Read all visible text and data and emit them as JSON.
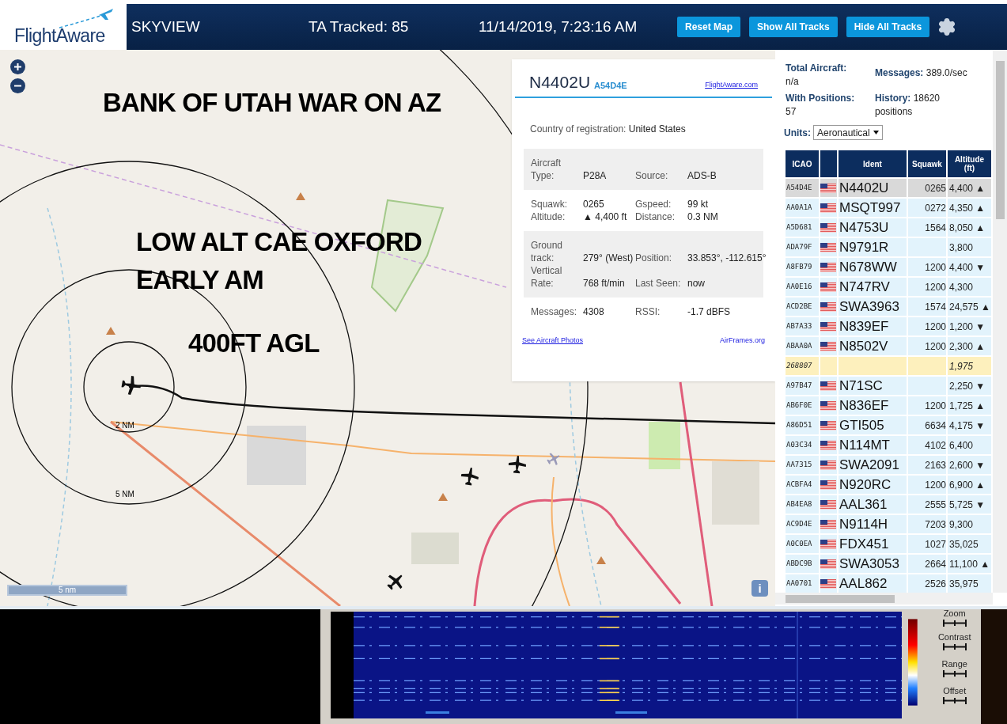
{
  "header": {
    "logo": "FlightAware",
    "title": "SKYVIEW",
    "tracked": "TA Tracked: 85",
    "datetime": "11/14/2019, 7:23:16 AM",
    "buttons": [
      "Reset Map",
      "Show All Tracks",
      "Hide All Tracks"
    ]
  },
  "map": {
    "annotations": [
      "BANK OF UTAH WAR ON AZ",
      "LOW ALT CAE OXFORD",
      "EARLY AM",
      "400FT AGL"
    ],
    "ring_labels": [
      "2 NM",
      "5 NM"
    ],
    "scale": "5 nm",
    "info": "i"
  },
  "popup": {
    "ident": "N4402U",
    "hex": "A54D4E",
    "site_link": "FlightAware.com",
    "country_label": "Country of registration:",
    "country": "United States",
    "sections": [
      {
        "shaded": true,
        "fields": [
          {
            "label": "Aircraft Type:",
            "value": "P28A"
          },
          {
            "label": "Source:",
            "value": "ADS-B"
          }
        ]
      },
      {
        "shaded": false,
        "fields": [
          {
            "label": "Squawk:",
            "value": "0265"
          },
          {
            "label": "Gspeed:",
            "value": "99 kt"
          },
          {
            "label": "Altitude:",
            "value": "▲ 4,400 ft"
          },
          {
            "label": "Distance:",
            "value": "0.3 NM"
          }
        ]
      },
      {
        "shaded": true,
        "fields": [
          {
            "label": "Ground track:",
            "value": "279° (West)"
          },
          {
            "label": "Position:",
            "value": "33.853°, -112.615°"
          },
          {
            "label": "Vertical Rate:",
            "value": "768 ft/min"
          },
          {
            "label": "Last Seen:",
            "value": "now"
          }
        ]
      },
      {
        "shaded": false,
        "fields": [
          {
            "label": "Messages:",
            "value": "4308"
          },
          {
            "label": "RSSI:",
            "value": "-1.7 dBFS"
          }
        ]
      }
    ],
    "links": [
      "See Aircraft Photos",
      "AirFrames.org"
    ]
  },
  "stats": [
    "**Total Aircraft:** n/a",
    "**Messages:** 389.0/sec",
    "**With Positions:** 57",
    "**History:** 18620 positions"
  ],
  "units": {
    "label": "Units:",
    "value": "Aeronautical"
  },
  "table": {
    "columns": [
      "ICAO",
      "Ident",
      "Squawk",
      "Altitude (ft)"
    ],
    "rows": [
      {
        "icao": "A54D4E",
        "ident": "N4402U",
        "squawk": "0265",
        "altitude": "4,400 ▲",
        "kind": "positioned",
        "selected": true
      },
      {
        "icao": "AA0A1A",
        "ident": "MSQT997",
        "squawk": "0272",
        "altitude": "4,350 ▲",
        "kind": "positioned",
        "selected": false
      },
      {
        "icao": "A5D681",
        "ident": "N4753U",
        "squawk": "1564",
        "altitude": "8,050 ▲",
        "kind": "positioned",
        "selected": false
      },
      {
        "icao": "ADA79F",
        "ident": "N9791R",
        "altitude": "3,800",
        "kind": "positioned",
        "selected": false
      },
      {
        "icao": "A8FB79",
        "ident": "N678WW",
        "squawk": "1200",
        "altitude": "4,400 ▼",
        "kind": "positioned",
        "selected": false
      },
      {
        "icao": "AA0E16",
        "ident": "N747RV",
        "squawk": "1200",
        "altitude": "4,300",
        "kind": "positioned",
        "selected": false
      },
      {
        "icao": "ACD2BE",
        "ident": "SWA3963",
        "squawk": "1574",
        "altitude": "24,575 ▲",
        "kind": "positioned",
        "selected": false
      },
      {
        "icao": "AB7A33",
        "ident": "N839EF",
        "squawk": "1200",
        "altitude": "1,200 ▼",
        "kind": "positioned",
        "selected": false
      },
      {
        "icao": "ABAA0A",
        "ident": "N8502V",
        "squawk": "1200",
        "altitude": "2,300 ▲",
        "kind": "positioned",
        "selected": false
      },
      {
        "icao": "268807",
        "altitude": "1,975",
        "kind": "no-position",
        "selected": false
      },
      {
        "icao": "A97B47",
        "ident": "N71SC",
        "altitude": "2,250 ▼",
        "kind": "positioned",
        "selected": false
      },
      {
        "icao": "AB6F0E",
        "ident": "N836EF",
        "squawk": "1200",
        "altitude": "1,725 ▲",
        "kind": "positioned",
        "selected": false
      },
      {
        "icao": "A86D51",
        "ident": "GTI505",
        "squawk": "6634",
        "altitude": "4,175 ▼",
        "kind": "positioned",
        "selected": false
      },
      {
        "icao": "A03C34",
        "ident": "N114MT",
        "squawk": "4102",
        "altitude": "6,400",
        "kind": "positioned",
        "selected": false
      },
      {
        "icao": "AA7315",
        "ident": "SWA2091",
        "squawk": "2163",
        "altitude": "2,600 ▼",
        "kind": "positioned",
        "selected": false
      },
      {
        "icao": "ACBFA4",
        "ident": "N920RC",
        "squawk": "1200",
        "altitude": "6,900 ▲",
        "kind": "positioned",
        "selected": false
      },
      {
        "icao": "AB4EA8",
        "ident": "AAL361",
        "squawk": "2555",
        "altitude": "5,725 ▼",
        "kind": "positioned",
        "selected": false
      },
      {
        "icao": "AC9D4E",
        "ident": "N9114H",
        "squawk": "7203",
        "altitude": "9,300",
        "kind": "positioned",
        "selected": false
      },
      {
        "icao": "A0C0EA",
        "ident": "FDX451",
        "squawk": "1027",
        "altitude": "35,025",
        "kind": "positioned",
        "selected": false
      },
      {
        "icao": "ABDC9B",
        "ident": "SWA3053",
        "squawk": "2664",
        "altitude": "11,100 ▲",
        "kind": "positioned",
        "selected": false
      },
      {
        "icao": "AA0701",
        "ident": "AAL862",
        "squawk": "2526",
        "altitude": "35,975",
        "kind": "positioned",
        "selected": false
      }
    ]
  },
  "waterfall": {
    "controls": [
      "Zoom",
      "Contrast",
      "Range",
      "Offset"
    ]
  }
}
